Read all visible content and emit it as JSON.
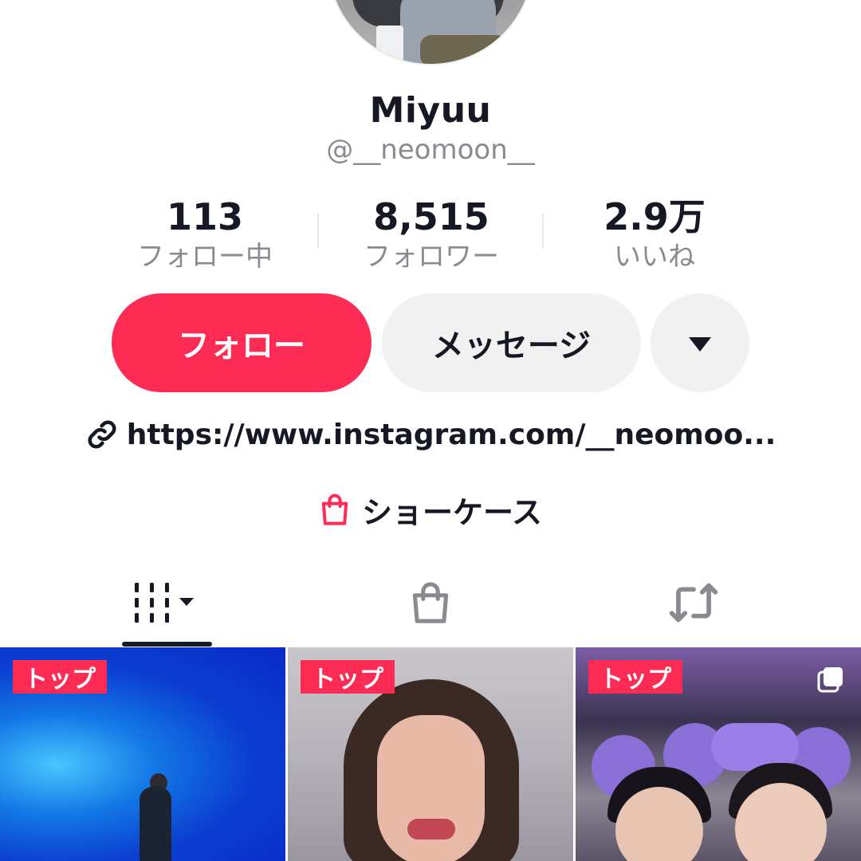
{
  "profile": {
    "display_name": "Miyuu",
    "handle": "@__neomoon__"
  },
  "stats": [
    {
      "value": "113",
      "label": "フォロー中"
    },
    {
      "value": "8,515",
      "label": "フォロワー"
    },
    {
      "value": "2.9万",
      "label": "いいね"
    }
  ],
  "actions": {
    "follow_label": "フォロー",
    "message_label": "メッセージ",
    "more_icon": "caret-down-icon"
  },
  "bio": {
    "link_text": "https://www.instagram.com/__neomoo...",
    "showcase_label": "ショーケース"
  },
  "tabs": [
    {
      "icon": "videos-grid-icon",
      "selected": true
    },
    {
      "icon": "shopping-bag-icon",
      "selected": false
    },
    {
      "icon": "repost-icon",
      "selected": false
    }
  ],
  "videos": [
    {
      "badge": "トップ"
    },
    {
      "badge": "トップ"
    },
    {
      "badge": "トップ",
      "multi_photo": true
    }
  ],
  "colors": {
    "accent": "#fe2c55",
    "secondary_button": "#f1f1f2",
    "muted_text": "#8a8b91"
  }
}
